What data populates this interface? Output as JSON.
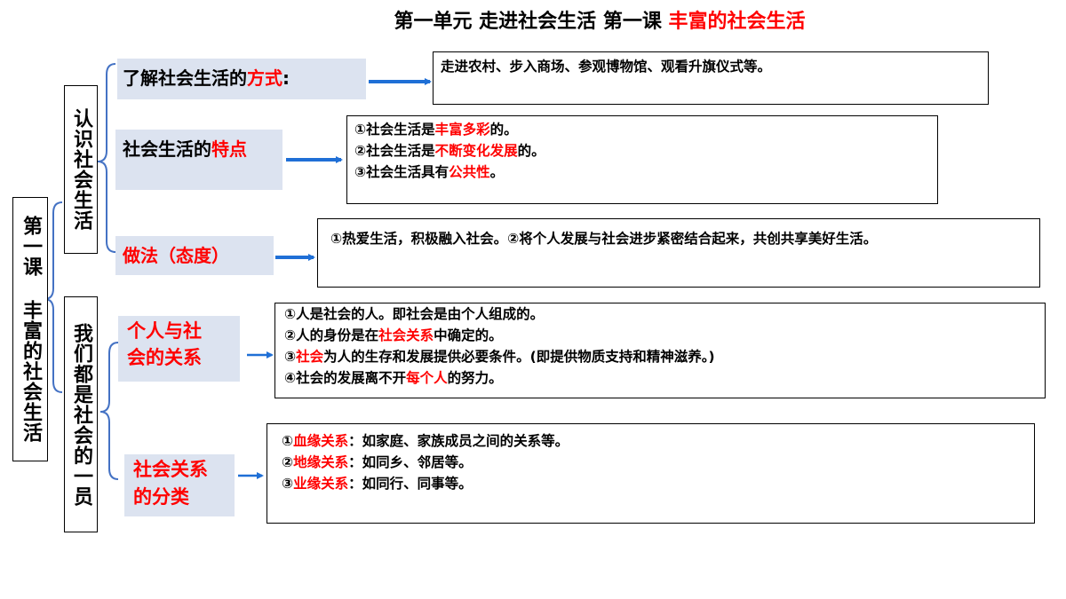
{
  "title": {
    "prefix": "第一单元 走进社会生活  第一课  ",
    "highlight": "丰富的社会生活"
  },
  "root": {
    "label": "第一课 丰富的社会生活"
  },
  "groups": [
    {
      "label": "认识社会生活"
    },
    {
      "label": "我们都是社会的一员"
    }
  ],
  "items": {
    "way": {
      "label_prefix": "了解社会生活的",
      "label_highlight": "方式",
      "label_suffix": ":",
      "content": "走进农村、步入商场、参观博物馆、观看升旗仪式等。"
    },
    "feature": {
      "label_prefix": "社会生活的",
      "label_highlight": "特点",
      "lines": [
        {
          "a": "①社会生活是",
          "b": "丰富多彩",
          "c": "的。"
        },
        {
          "a": "②社会生活是",
          "b": "不断变化发展",
          "c": "的。"
        },
        {
          "a": "③社会生活具有",
          "b": "公共性",
          "c": "。"
        }
      ]
    },
    "practice": {
      "label": "做法（态度）",
      "content": "①热爱生活，积极融入社会。②将个人发展与社会进步紧密结合起来，共创共享美好生活。"
    },
    "relation": {
      "label_line1": "个人与社",
      "label_line2": "会的关系",
      "lines": [
        {
          "a": "①人是社会的人。即社会是由个人组成的。",
          "b": "",
          "c": ""
        },
        {
          "a": "②人的身份是在",
          "b": "社会关系",
          "c": "中确定的。"
        },
        {
          "a": "③",
          "b": "社会",
          "c": "为人的生存和发展提供必要条件。(即提供物质支持和精神滋养。)"
        },
        {
          "a": "④社会的发展离不开",
          "b": "每个人",
          "c": "的努力。"
        }
      ]
    },
    "category": {
      "label_line1": "社会关系",
      "label_line2": "的分类",
      "lines": [
        {
          "a": "①",
          "b": "血缘关系",
          "c": "：如家庭、家族成员之间的关系等。"
        },
        {
          "a": "②",
          "b": "地缘关系",
          "c": "：如同乡、邻居等。"
        },
        {
          "a": "③",
          "b": "业缘关系",
          "c": "：如同行、同事等。"
        }
      ]
    }
  },
  "colors": {
    "highlight": "#ff0000",
    "label_bg": "#dce3f0",
    "arrow": "#1f6fd6",
    "bracket": "#4472c4"
  }
}
